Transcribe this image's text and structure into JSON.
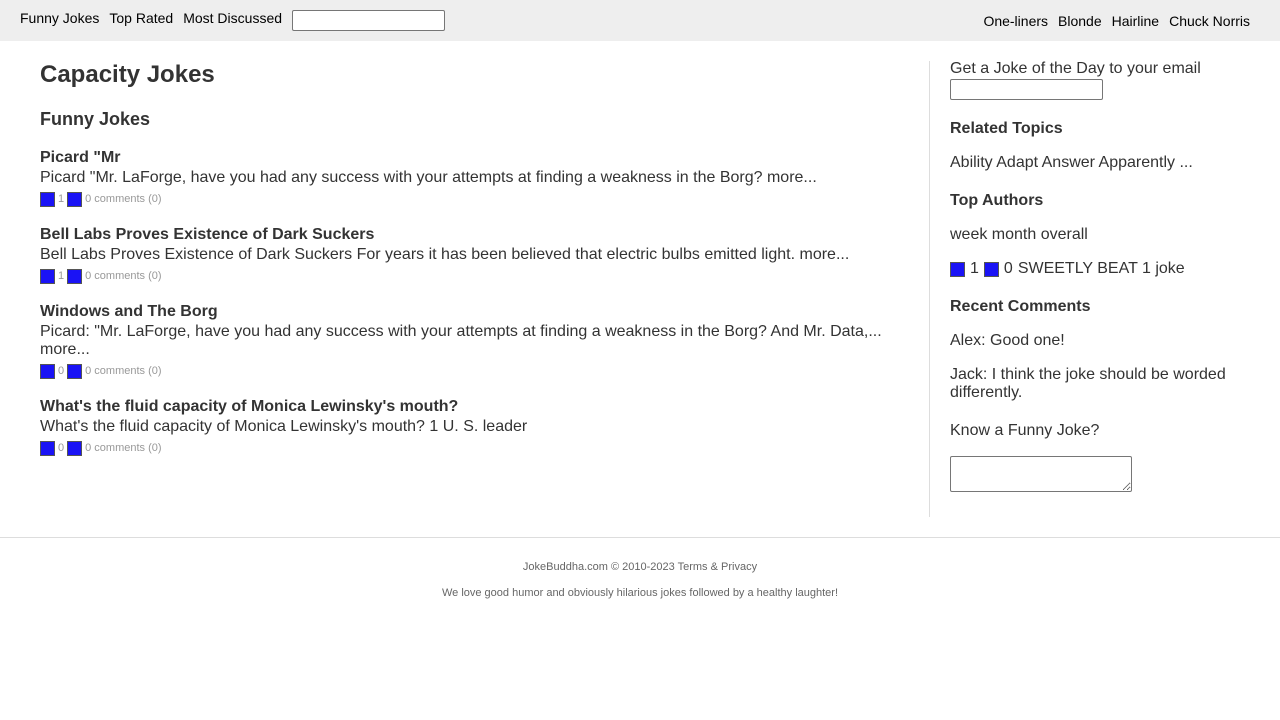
{
  "topnav": {
    "left": [
      "Funny Jokes",
      "Top Rated",
      "Most Discussed"
    ],
    "search_value": "",
    "right": [
      "One-liners",
      "Blonde",
      "Hairline",
      "Chuck Norris"
    ]
  },
  "main": {
    "title": "Capacity Jokes",
    "section": "Funny Jokes",
    "jokes": [
      {
        "title": "Picard \"Mr",
        "text": "Picard \"Mr. LaForge, have you had any success with your attempts at finding a weakness in the Borg?",
        "more": "more...",
        "votes": "1",
        "comments": "0 comments (0)"
      },
      {
        "title": "Bell Labs Proves Existence of Dark Suckers",
        "text": "Bell Labs Proves Existence of Dark Suckers For years it has been believed that electric bulbs emitted light.",
        "more": "more...",
        "votes": "1",
        "comments": "0 comments (0)"
      },
      {
        "title": "Windows and The Borg",
        "text": "Picard: \"Mr. LaForge, have you had any success with your attempts at finding a weakness in the Borg? And Mr. Data,...",
        "more": "more...",
        "votes": "0",
        "comments": "0 comments (0)"
      },
      {
        "title": "What's the fluid capacity of Monica Lewinsky's mouth?",
        "text": "What's the fluid capacity of Monica Lewinsky's mouth? 1 U. S. leader",
        "more": "",
        "votes": "0",
        "comments": "0 comments (0)"
      }
    ]
  },
  "sidebar": {
    "subscribe_label": "Get a Joke of the Day to your email",
    "related_heading": "Related Topics",
    "related_text": "Ability Adapt Answer Apparently ...",
    "authors_heading": "Top Authors",
    "authors_periods": "week month overall",
    "authors_up": "1",
    "authors_down": "0",
    "authors_entry": "SWEETLY BEAT 1 joke",
    "comments_heading": "Recent Comments",
    "comments": [
      "Alex: Good one!",
      "Jack: I think the joke should be worded differently."
    ],
    "know_joke": "Know a Funny Joke?"
  },
  "footer": {
    "copyright": "JokeBuddha.com © 2010-2023",
    "terms": "Terms & Privacy",
    "tagline": "We love good humor and obviously hilarious jokes followed by a healthy laughter!"
  },
  "colors": {
    "vote_icon": "#1a13f5",
    "topbar_bg": "#eeeeee",
    "text": "#333333",
    "meta_text": "#999999"
  }
}
